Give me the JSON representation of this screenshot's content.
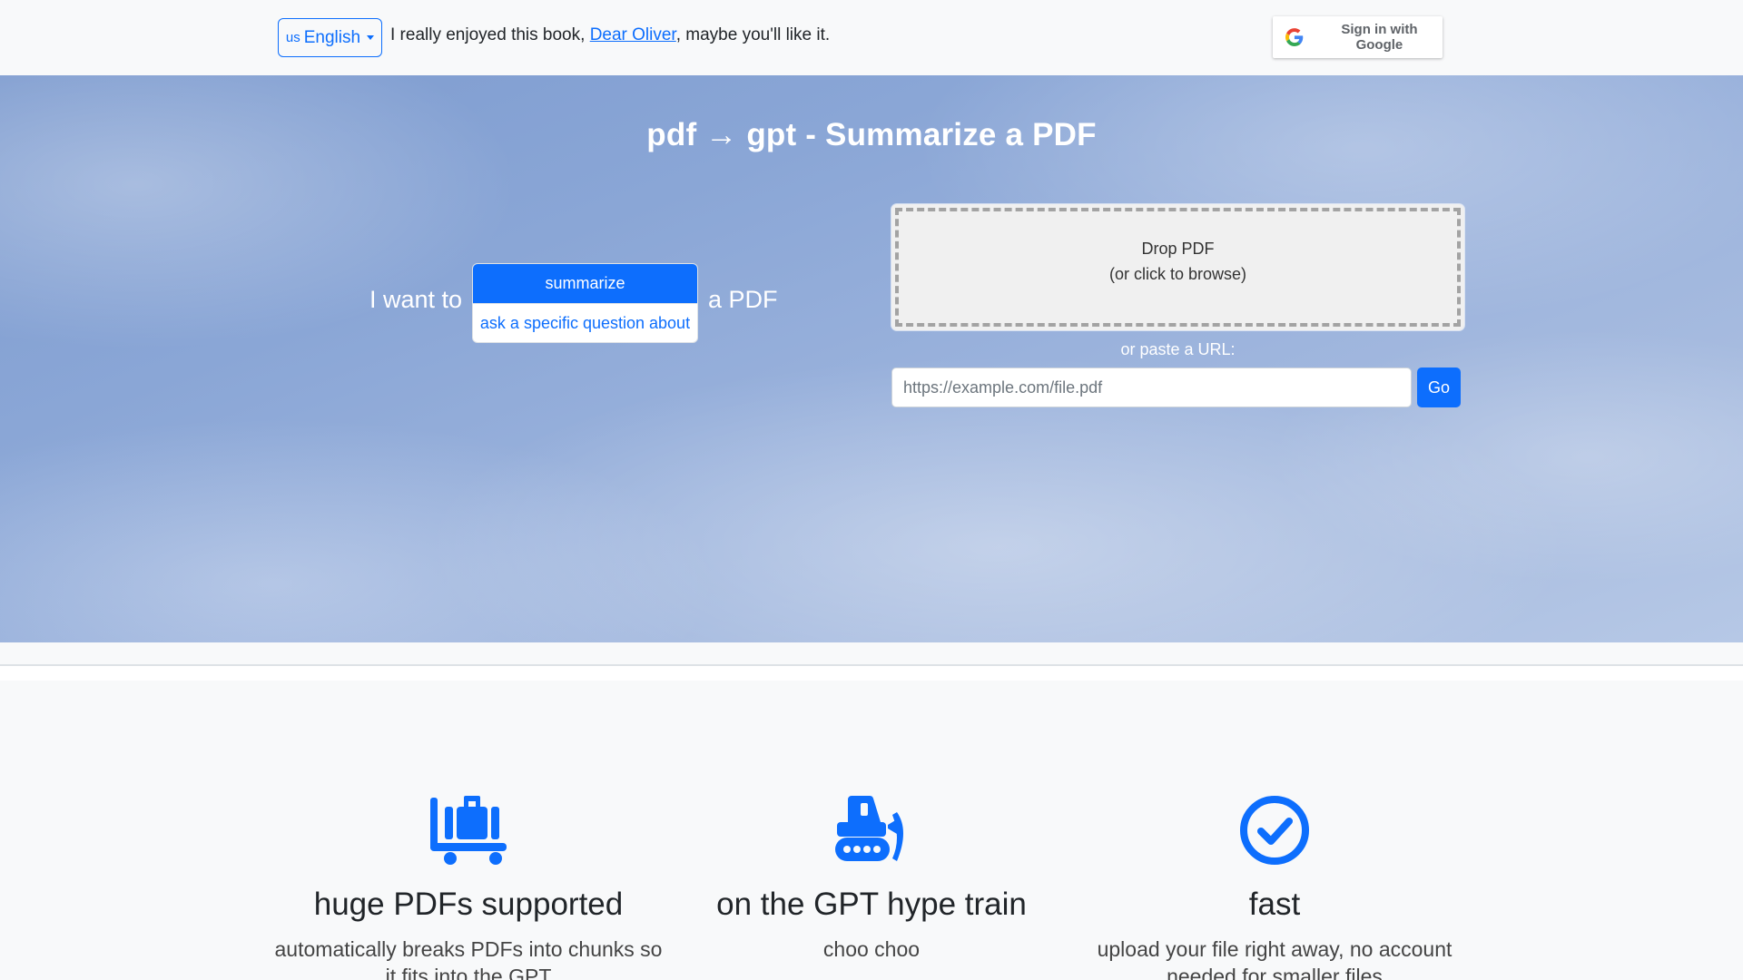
{
  "topbar": {
    "language": {
      "flag": "us",
      "label": "English"
    },
    "tagline": {
      "prefix": "I really enjoyed this book, ",
      "link": "Dear Oliver",
      "suffix": ", maybe you'll like it."
    },
    "google_signin": {
      "label": "Sign in with Google",
      "icon": "google-g-icon"
    }
  },
  "hero": {
    "title": "pdf → gpt - Summarize a PDF",
    "want_label": "I want to",
    "after_label": "a PDF",
    "modes": [
      {
        "label": "summarize",
        "active": true
      },
      {
        "label": "ask a specific question about",
        "active": false
      }
    ],
    "dropzone": {
      "line1": "Drop PDF",
      "line2": "(or click to browse)"
    },
    "paste_label": "or paste a URL:",
    "url_input": {
      "value": "",
      "placeholder": "https://example.com/file.pdf"
    },
    "go_label": "Go"
  },
  "features": [
    {
      "icon": "luggage-cart-icon",
      "title": "huge PDFs supported",
      "text": "automatically breaks PDFs into chunks so it fits into the GPT"
    },
    {
      "icon": "snowplow-train-icon",
      "title": "on the GPT hype train",
      "text": "choo choo"
    },
    {
      "icon": "check-circle-icon",
      "title": "fast",
      "text": "upload your file right away, no account needed for smaller files"
    }
  ],
  "colors": {
    "primary": "#0d6efd",
    "page_bg": "#f8f9fa",
    "hero_sky": "#8aa6d6"
  }
}
